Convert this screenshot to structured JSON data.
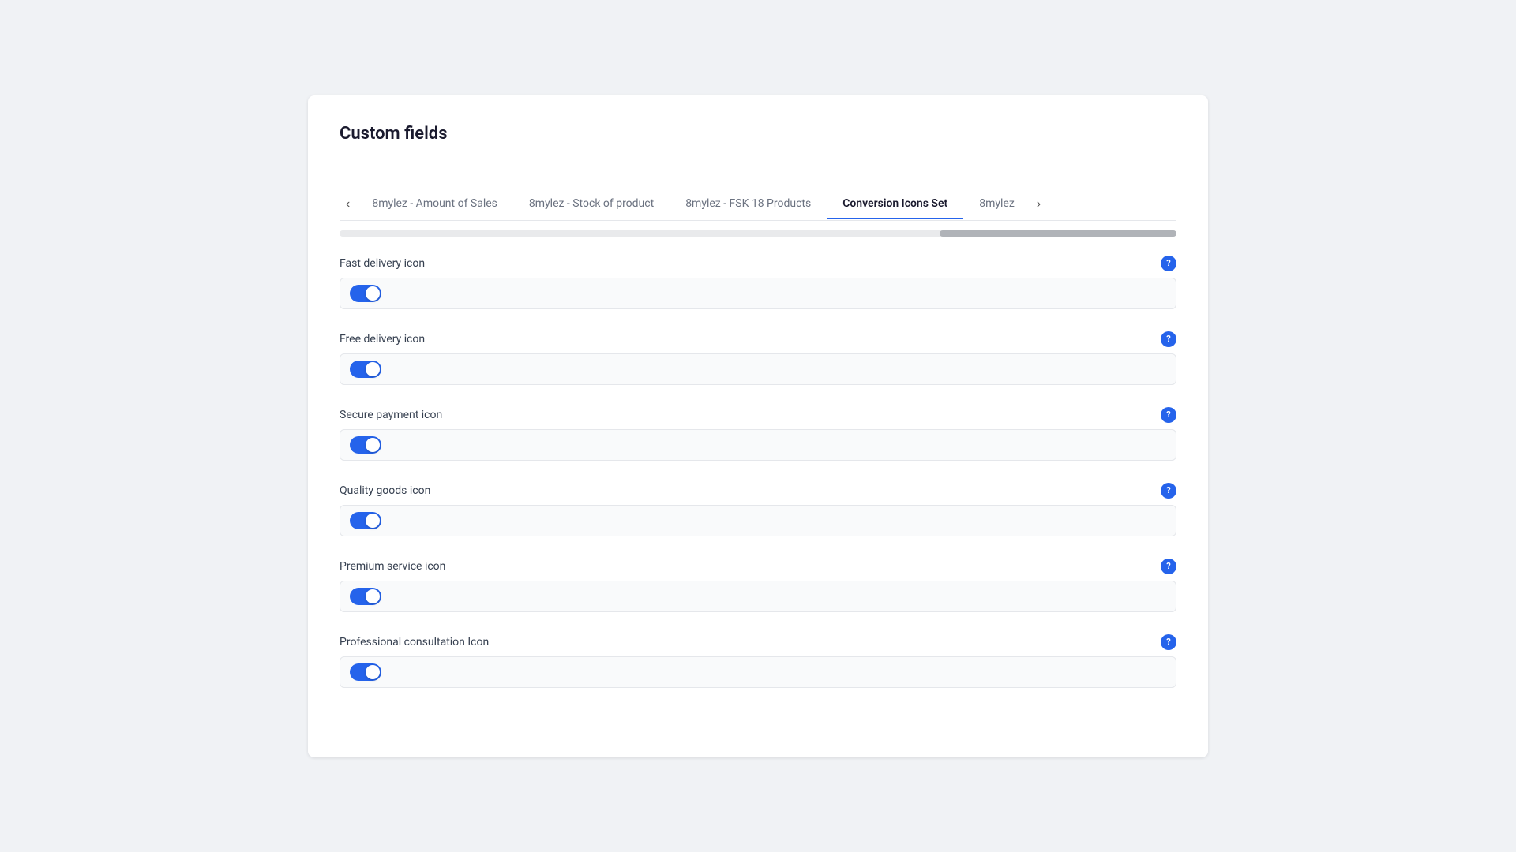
{
  "page": {
    "title": "Custom fields"
  },
  "tabs": {
    "prev_arrow": "‹",
    "next_arrow": "›",
    "items": [
      {
        "id": "tab-amount",
        "label": "8mylez - Amount of Sales",
        "active": false
      },
      {
        "id": "tab-stock",
        "label": "8mylez - Stock of product",
        "active": false
      },
      {
        "id": "tab-fsk",
        "label": "8mylez - FSK 18 Products",
        "active": false
      },
      {
        "id": "tab-conversion",
        "label": "Conversion Icons Set",
        "active": true
      },
      {
        "id": "tab-8mylez",
        "label": "8mylez",
        "active": false
      }
    ]
  },
  "fields": [
    {
      "id": "fast-delivery",
      "label": "Fast delivery icon",
      "enabled": true
    },
    {
      "id": "free-delivery",
      "label": "Free delivery icon",
      "enabled": true
    },
    {
      "id": "secure-payment",
      "label": "Secure payment icon",
      "enabled": true
    },
    {
      "id": "quality-goods",
      "label": "Quality goods icon",
      "enabled": true
    },
    {
      "id": "premium-service",
      "label": "Premium service icon",
      "enabled": true
    },
    {
      "id": "professional-consultation",
      "label": "Professional consultation Icon",
      "enabled": true
    }
  ],
  "help_icon": {
    "label": "?"
  }
}
